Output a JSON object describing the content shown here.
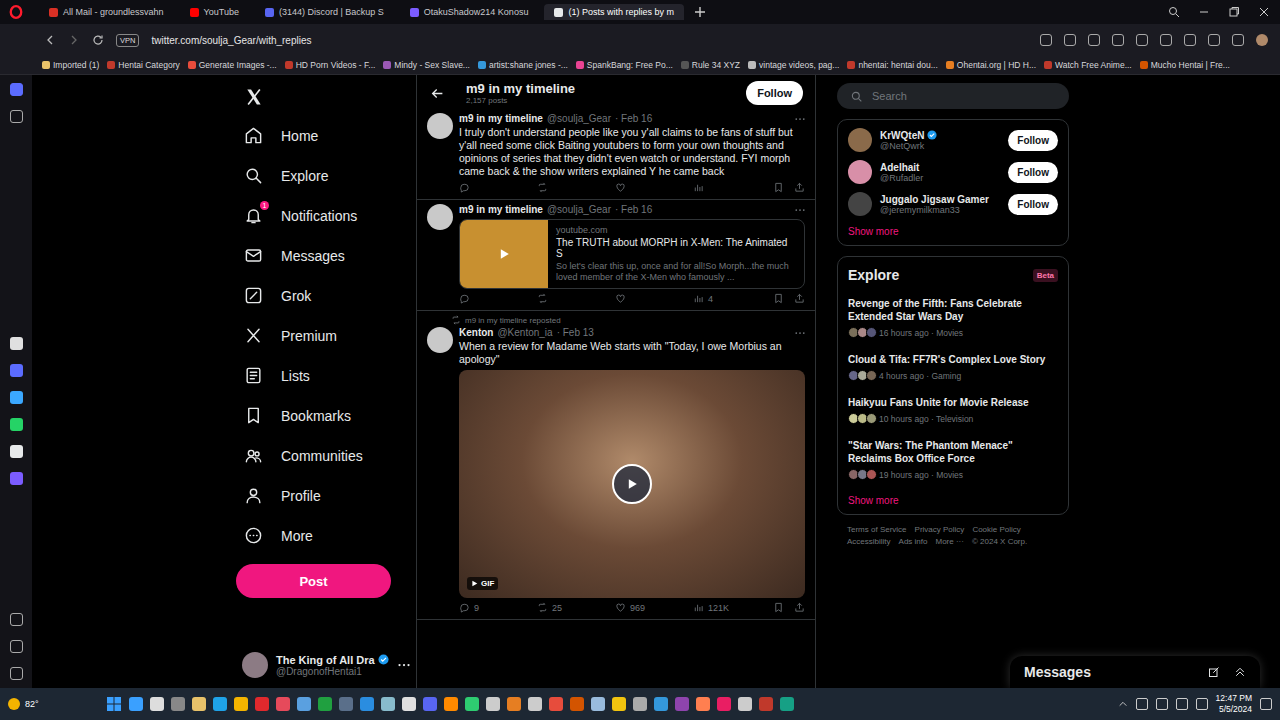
{
  "browser": {
    "tabs": [
      {
        "title": "All Mail - groundlessvahn",
        "selected": false
      },
      {
        "title": "YouTube",
        "selected": false
      },
      {
        "title": "(3144) Discord | Backup S",
        "selected": false
      },
      {
        "title": "OtakuShadow214 Konosu",
        "selected": false
      },
      {
        "title": "(1) Posts with replies by m",
        "selected": true
      }
    ],
    "vpn": "VPN",
    "url": "twitter.com/soulja_Gear/with_replies",
    "bookmarks": [
      "Imported (1)",
      "Hentai Category",
      "Generate Images -...",
      "HD Porn Videos - F...",
      "Mindy - Sex Slave...",
      "artist:shane jones -...",
      "SpankBang: Free Po...",
      "Rule 34 XYZ",
      "vintage videos, pag...",
      "nhentai: hentai dou...",
      "Ohentai.org | HD H...",
      "Watch Free Anime...",
      "Mucho Hentai | Fre..."
    ]
  },
  "x": {
    "nav": [
      {
        "label": "Home",
        "selected": false
      },
      {
        "label": "Explore",
        "selected": false
      },
      {
        "label": "Notifications",
        "selected": false,
        "badge": "1"
      },
      {
        "label": "Messages",
        "selected": false
      },
      {
        "label": "Grok",
        "selected": false
      },
      {
        "label": "Premium",
        "selected": false
      },
      {
        "label": "Lists",
        "selected": false
      },
      {
        "label": "Bookmarks",
        "selected": false
      },
      {
        "label": "Communities",
        "selected": false
      },
      {
        "label": "Profile",
        "selected": false
      },
      {
        "label": "More",
        "selected": false
      }
    ],
    "post_button": "Post",
    "account": {
      "name": "The King of All Dra",
      "handle": "@DragonofHentai1",
      "verified": true
    },
    "profile": {
      "name": "m9 in my timeline",
      "posts": "2,157 posts",
      "follow": "Follow"
    },
    "posts": [
      {
        "name": "m9 in my timeline",
        "handle": "@soulja_Gear",
        "date": "· Feb 16",
        "kind": "text",
        "text": "I truly don't understand people like you y'all claims to be fans of stuff but y'all need some click Baiting youtubers to form your own thoughts and opinions of series that they didn't even watch or understand. FYI morph came back & the show writers explained Y he came back",
        "stats": [
          "",
          "",
          "",
          ""
        ]
      },
      {
        "name": "m9 in my timeline",
        "handle": "@soulja_Gear",
        "date": "· Feb 16",
        "kind": "link",
        "card": {
          "domain": "youtube.com",
          "title": "The TRUTH about MORPH in X-Men: The Animated S",
          "description": "So let's clear this up, once and for all!So Morph...the much loved member of the X-Men who famously ..."
        },
        "stats": [
          "",
          "",
          "",
          "4"
        ]
      },
      {
        "repost": "m9 in my timeline reposted",
        "name": "Kenton",
        "handle": "@Kenton_ia",
        "date": "· Feb 13",
        "kind": "media",
        "text": "When a review for Madame Web starts with \"Today, I owe Morbius an apology\"",
        "media": {
          "badge": "GIF"
        },
        "stats": [
          "9",
          "25",
          "969",
          "121K"
        ]
      }
    ],
    "search": {
      "placeholder": "Search"
    },
    "who_to_follow": {
      "accounts": [
        {
          "name": "KrWQteN",
          "handle": "@NetQwrk",
          "verified": true,
          "follow": "Follow"
        },
        {
          "name": "Adelhait",
          "handle": "@Rufadler",
          "verified": false,
          "follow": "Follow"
        },
        {
          "name": "Juggalo Jigsaw Gamer",
          "handle": "@jeremymilkman33",
          "verified": false,
          "follow": "Follow"
        }
      ],
      "show_more": "Show more"
    },
    "explore": {
      "title": "Explore",
      "badge": "Beta",
      "trends": [
        {
          "title": "Revenge of the Fifth: Fans Celebrate Extended Star Wars Day",
          "meta": "16 hours ago · Movies"
        },
        {
          "title": "Cloud & Tifa: FF7R's Complex Love Story",
          "meta": "4 hours ago · Gaming"
        },
        {
          "title": "Haikyuu Fans Unite for Movie Release",
          "meta": "10 hours ago · Television"
        },
        {
          "title": "\"Star Wars: The Phantom Menace\" Reclaims Box Office Force",
          "meta": "19 hours ago · Movies"
        }
      ],
      "show_more": "Show more"
    },
    "footer": [
      "Terms of Service",
      "Privacy Policy",
      "Cookie Policy",
      "Accessibility",
      "Ads info",
      "More ···",
      "© 2024 X Corp."
    ],
    "messages": "Messages"
  },
  "taskbar": {
    "weather": "82°",
    "time": "12:47 PM",
    "date": "5/5/2024"
  }
}
